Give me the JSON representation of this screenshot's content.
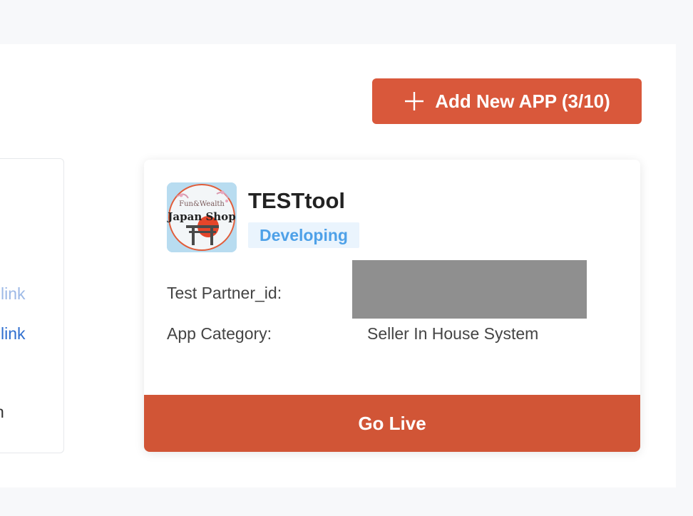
{
  "toolbar": {
    "add_label": "Add New APP (3/10)"
  },
  "left_card": {
    "link_1": "link",
    "link_2": "link",
    "trailing_char": "n"
  },
  "app_card": {
    "logo": {
      "line_1": "Fun&Wealth",
      "line_2": "Japan Shop"
    },
    "name": "TESTtool",
    "status": "Developing",
    "fields": [
      {
        "label": "Test Partner_id:",
        "value": ""
      },
      {
        "label": "App Category:",
        "value": "Seller In House System"
      }
    ],
    "go_live_label": "Go Live"
  },
  "colors": {
    "accent": "#d9583b",
    "go_live": "#d15536",
    "status_text": "#4ea1e8",
    "status_bg": "#eaf4fd",
    "link": "#2f6fcf"
  },
  "icons": {
    "add": "plus-icon"
  }
}
